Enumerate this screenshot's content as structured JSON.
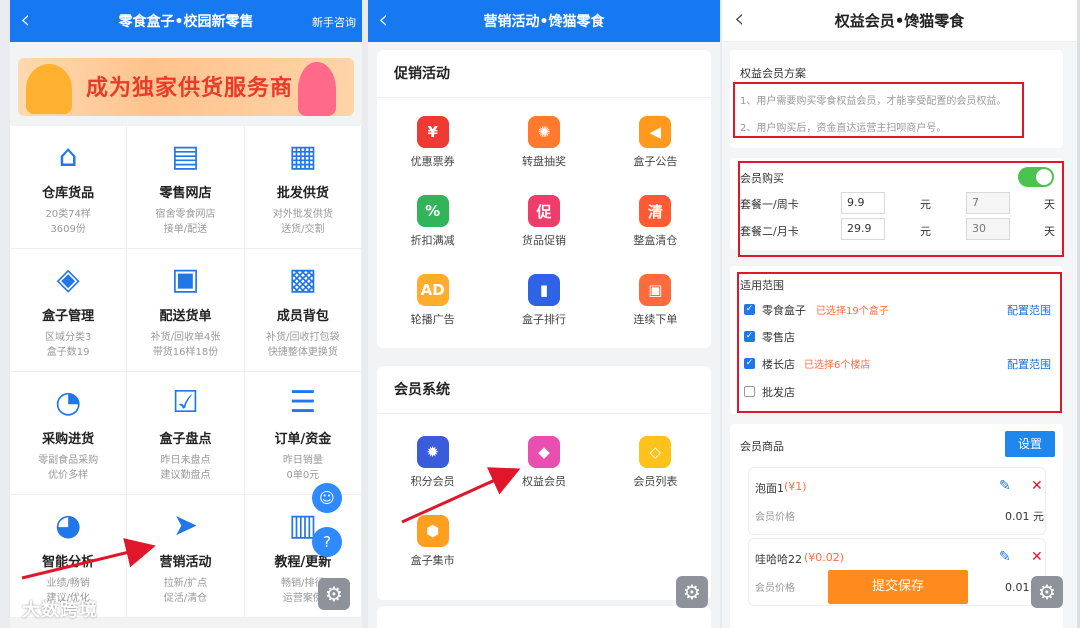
{
  "panel1": {
    "title": "零食盒子•校园新零售",
    "extra": "新手咨询",
    "banner": "成为独家供货服务商",
    "cells": [
      {
        "name": "仓库货品",
        "l1": "20类74样",
        "l2": "3609份",
        "icon": "warehouse-icon",
        "color": "#2176e8"
      },
      {
        "name": "零售网店",
        "l1": "宿舍零食网店",
        "l2": "接单/配送",
        "icon": "shop-icon",
        "color": "#2176e8"
      },
      {
        "name": "批发供货",
        "l1": "对外批发供货",
        "l2": "送货/交割",
        "icon": "truck-icon",
        "color": "#2176e8"
      },
      {
        "name": "盒子管理",
        "l1": "区域分类3",
        "l2": "盒子数19",
        "icon": "box-icon",
        "color": "#2176e8"
      },
      {
        "name": "配送货单",
        "l1": "补货/回收单4张",
        "l2": "带货16样18份",
        "icon": "waybill-icon",
        "color": "#2176e8"
      },
      {
        "name": "成员背包",
        "l1": "补货/回收打包袋",
        "l2": "快捷整体更换货",
        "icon": "backpack-icon",
        "color": "#2176e8"
      },
      {
        "name": "采购进货",
        "l1": "零副食品采购",
        "l2": "优价多样",
        "icon": "purchase-icon",
        "color": "#2176e8"
      },
      {
        "name": "盒子盘点",
        "l1": "昨日未盘点",
        "l2": "建议勤盘点",
        "icon": "inventory-icon",
        "color": "#2176e8"
      },
      {
        "name": "订单/资金",
        "l1": "昨日销量",
        "l2": "0单0元",
        "icon": "order-icon",
        "color": "#2176e8"
      },
      {
        "name": "智能分析",
        "l1": "业绩/畅销",
        "l2": "建议/优化",
        "icon": "analysis-icon",
        "color": "#2176e8"
      },
      {
        "name": "营销活动",
        "l1": "拉新/扩点",
        "l2": "促活/清仓",
        "icon": "send-icon",
        "color": "#2176e8"
      },
      {
        "name": "教程/更新",
        "l1": "畅销/排行",
        "l2": "运营案例",
        "icon": "book-icon",
        "color": "#2176e8"
      }
    ],
    "watermark": "大数跨境"
  },
  "panel2": {
    "title": "营销活动•馋猫零食",
    "promo_title": "促销活动",
    "promo": [
      {
        "name": "优惠票券",
        "icon": "coupon-icon",
        "color": "#ef3a33"
      },
      {
        "name": "转盘抽奖",
        "icon": "wheel-icon",
        "color": "#ff7a2d"
      },
      {
        "name": "盒子公告",
        "icon": "megaphone-icon",
        "color": "#ff9a1f"
      },
      {
        "name": "折扣满减",
        "icon": "discount-icon",
        "color": "#33b35a"
      },
      {
        "name": "货品促销",
        "icon": "tag-icon",
        "color": "#ee3d6a"
      },
      {
        "name": "整盒清仓",
        "icon": "clearance-icon",
        "color": "#ff5a33"
      },
      {
        "name": "轮播广告",
        "icon": "ad-icon",
        "color": "#ffad2b"
      },
      {
        "name": "盒子排行",
        "icon": "rank-icon",
        "color": "#2e63e6"
      },
      {
        "name": "连续下单",
        "icon": "gift-icon",
        "color": "#ff6b3d"
      }
    ],
    "member_title": "会员系统",
    "member": [
      {
        "name": "积分会员",
        "icon": "points-badge-icon",
        "color": "#3a5cdb"
      },
      {
        "name": "权益会员",
        "icon": "medal-icon",
        "color": "#e94fb0"
      },
      {
        "name": "会员列表",
        "icon": "diamond-icon",
        "color": "#ffc21a"
      },
      {
        "name": "盒子集市",
        "icon": "hexagons-icon",
        "color": "#ff9f1f"
      }
    ]
  },
  "panel3": {
    "title": "权益会员•馋猫零食",
    "plan_title": "权益会员方案",
    "plan_notes": [
      "1、用户需要购买零食权益会员，才能享受配置的会员权益。",
      "2、用户购买后，资金直达运营主扫呗商户号。"
    ],
    "buy_label": "会员购买",
    "plans": [
      {
        "name": "套餐一/周卡",
        "price": "9.9",
        "yuan": "元",
        "days": "7",
        "day_unit": "天"
      },
      {
        "name": "套餐二/月卡",
        "price": "29.9",
        "yuan": "元",
        "days": "30",
        "day_unit": "天"
      }
    ],
    "scope_title": "适用范围",
    "scopes": [
      {
        "name": "零食盒子",
        "note": "已选择19个盒子",
        "checked": "✓",
        "link": "配置范围"
      },
      {
        "name": "零售店",
        "note": "",
        "checked": "✓",
        "link": ""
      },
      {
        "name": "楼长店",
        "note": "已选择6个楼店",
        "checked": "✓",
        "link": "配置范围"
      },
      {
        "name": "批发店",
        "note": "",
        "checked": "",
        "link": ""
      }
    ],
    "goods_title": "会员商品",
    "set_btn": "设置",
    "goods": [
      {
        "name": "泡面1",
        "price": "(¥1)",
        "member_label": "会员价格",
        "member_price": "0.01 元"
      },
      {
        "name": "哇哈哈22",
        "price": "(¥0.02)",
        "member_label": "会员价格",
        "member_price": "0.01 元"
      }
    ],
    "submit": "提交保存"
  }
}
